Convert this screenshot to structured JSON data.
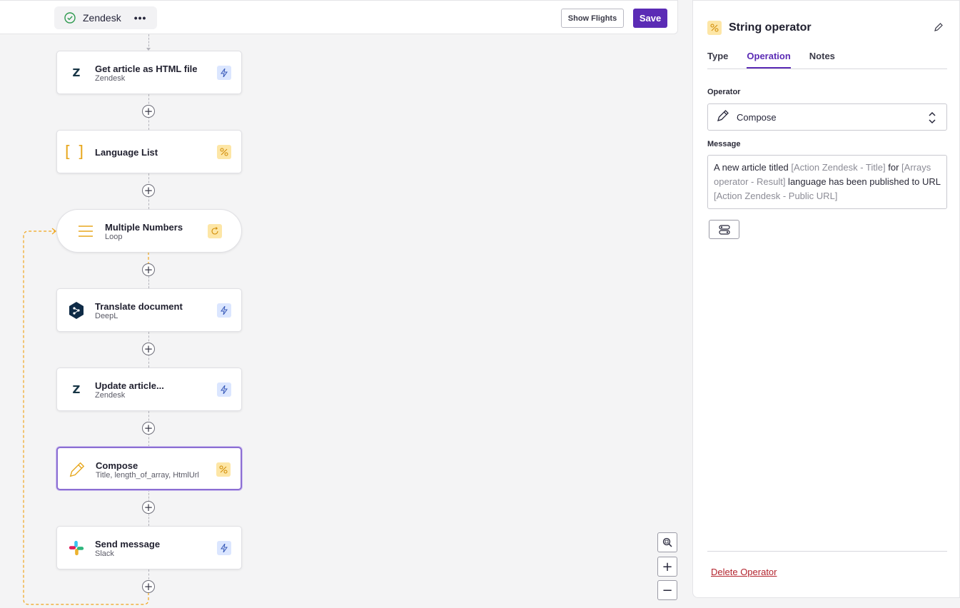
{
  "topbar": {
    "flow_name": "Zendesk",
    "show_flights_label": "Show Flights",
    "save_label": "Save"
  },
  "nodes": [
    {
      "title": "Get article as HTML file",
      "subtitle": "Zendesk",
      "icon": "zendesk-icon",
      "badge": "lightning-icon"
    },
    {
      "title": "Language List",
      "subtitle": "",
      "icon": "brackets-icon",
      "badge": "percent-operator-icon"
    },
    {
      "title": "Multiple Numbers",
      "subtitle": "Loop",
      "icon": "lines-icon",
      "badge": "loop-icon"
    },
    {
      "title": "Translate document",
      "subtitle": "DeepL",
      "icon": "deepl-icon",
      "badge": "lightning-icon"
    },
    {
      "title": "Update article...",
      "subtitle": "Zendesk",
      "icon": "zendesk-icon",
      "badge": "lightning-icon"
    },
    {
      "title": "Compose",
      "subtitle": "Title, length_of_array, HtmlUrl",
      "icon": "pencil-icon",
      "badge": "percent-operator-icon"
    },
    {
      "title": "Send message",
      "subtitle": "Slack",
      "icon": "slack-icon",
      "badge": "lightning-icon"
    }
  ],
  "zoom": {
    "plus": "+",
    "minus": "−"
  },
  "panel": {
    "title": "String operator",
    "tabs": [
      "Type",
      "Operation",
      "Notes"
    ],
    "active_tab": "Operation",
    "operator_label": "Operator",
    "operator_value": "Compose",
    "message_label": "Message",
    "message_parts": [
      {
        "text": "A new article titled ",
        "token": false
      },
      {
        "text": "[Action Zendesk - Title]",
        "token": true
      },
      {
        "text": " for ",
        "token": false
      },
      {
        "text": "[Arrays operator - Result]",
        "token": true
      },
      {
        "text": " language has been published to URL ",
        "token": false
      },
      {
        "text": "[Action Zendesk - Public URL]",
        "token": true
      }
    ],
    "delete_label": "Delete Operator"
  },
  "colors": {
    "accent": "#5b2bb5",
    "operator_yellow": "#fde6a6",
    "connector_blue": "#dbe6ff",
    "loop_line": "#f0a51a",
    "delete_red": "#b3242e"
  }
}
